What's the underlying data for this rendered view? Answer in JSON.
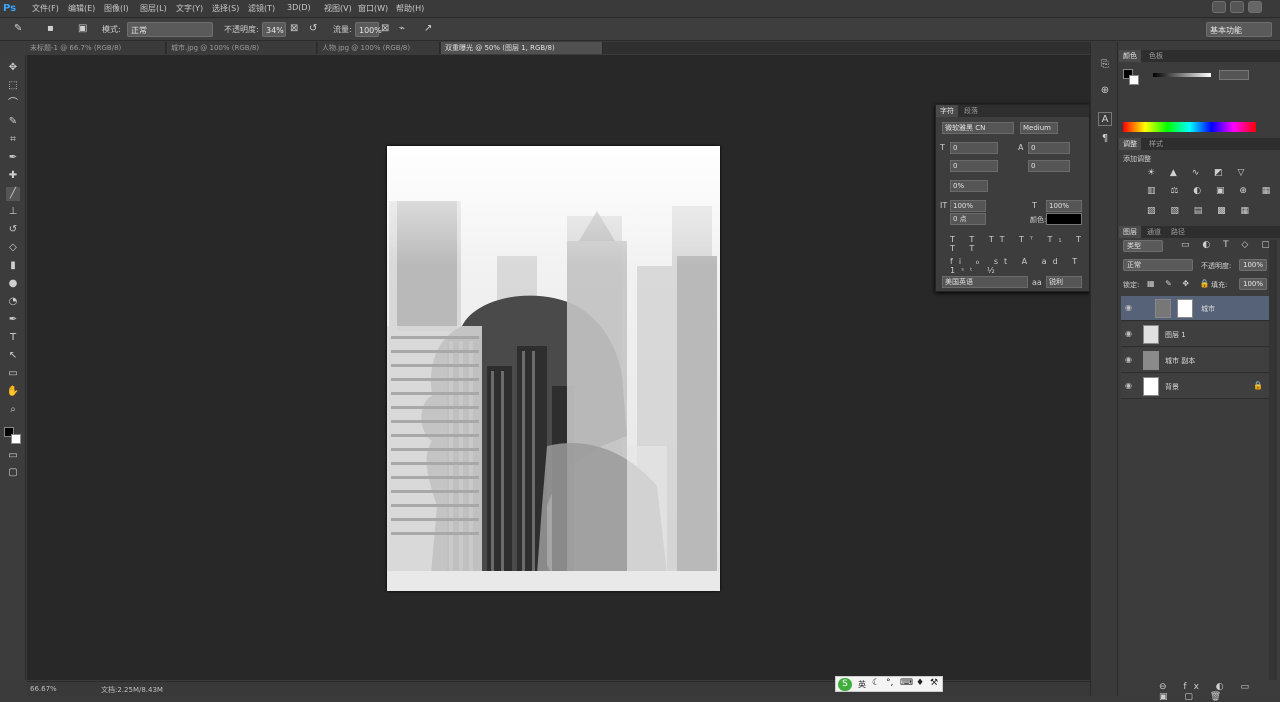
{
  "app": {
    "logo": "Ps"
  },
  "menu": [
    "文件(F)",
    "编辑(E)",
    "图像(I)",
    "图层(L)",
    "文字(Y)",
    "选择(S)",
    "滤镜(T)",
    "3D(D)",
    "视图(V)",
    "窗口(W)",
    "帮助(H)"
  ],
  "window_buttons": [
    "minimize",
    "maximize",
    "close"
  ],
  "options": {
    "mode_label": "模式:",
    "mode_value": "正常",
    "opacity_label": "不透明度:",
    "opacity_value": "34%",
    "flow_label": "流量:",
    "flow_value": "100%",
    "workspace": "基本功能"
  },
  "tabs": [
    {
      "label": "未标题-1 @ 66.7% (RGB/8)",
      "active": false
    },
    {
      "label": "城市.jpg @ 100% (RGB/8)",
      "active": false
    },
    {
      "label": "人物.jpg @ 100% (RGB/8)",
      "active": false
    },
    {
      "label": "双重曝光 @ 50% (图层 1, RGB/8)",
      "active": true
    }
  ],
  "tools": [
    "move-icon",
    "marquee-icon",
    "lasso-icon",
    "quick-select-icon",
    "crop-icon",
    "eyedropper-icon",
    "healing-icon",
    "brush-icon",
    "stamp-icon",
    "history-brush-icon",
    "eraser-icon",
    "gradient-icon",
    "blur-icon",
    "dodge-icon",
    "pen-icon",
    "type-icon",
    "path-select-icon",
    "shape-icon",
    "hand-icon",
    "zoom-icon"
  ],
  "status": {
    "zoom": "66.67%",
    "doc": "文档:2.25M/8.43M"
  },
  "dock_icons": [
    "history-icon",
    "color-sampler-icon",
    "character-icon",
    "paragraph-icon"
  ],
  "color_panel": {
    "tabs": [
      "颜色",
      "色板"
    ]
  },
  "adjustments_panel": {
    "tabs": [
      "调整",
      "样式"
    ],
    "title": "添加调整"
  },
  "layers_panel": {
    "tabs": [
      "图层",
      "通道",
      "路径"
    ],
    "kind_label": "类型",
    "blend_mode": "正常",
    "opacity_label": "不透明度:",
    "opacity_value": "100%",
    "lock_label": "锁定:",
    "fill_label": "填充:",
    "fill_value": "100%",
    "layers": [
      {
        "name": "城市",
        "selected": true,
        "has_mask": true
      },
      {
        "name": "图层 1",
        "selected": false,
        "has_mask": false
      },
      {
        "name": "城市 副本",
        "selected": false,
        "has_mask": false
      },
      {
        "name": "背景",
        "selected": false,
        "has_mask": false
      }
    ]
  },
  "character_panel": {
    "tabs": [
      "字符",
      "段落"
    ],
    "font_family": "微软雅黑 CN",
    "font_style": "Medium",
    "size": "0",
    "leading": "0",
    "tracking": "0%",
    "vertical_scale": "100%",
    "horizontal_scale": "100%",
    "baseline": "0 点",
    "color_label": "颜色:",
    "language": "美国英语",
    "aa": "锐利"
  },
  "ime_icons": [
    "S",
    "英",
    "moon",
    "dot",
    "keyboard",
    "shirt",
    "wrench"
  ],
  "colors": {
    "fg": "#000000",
    "bg": "#ffffff",
    "selected_layer": "#566277",
    "canvas_bg": "#282828"
  }
}
